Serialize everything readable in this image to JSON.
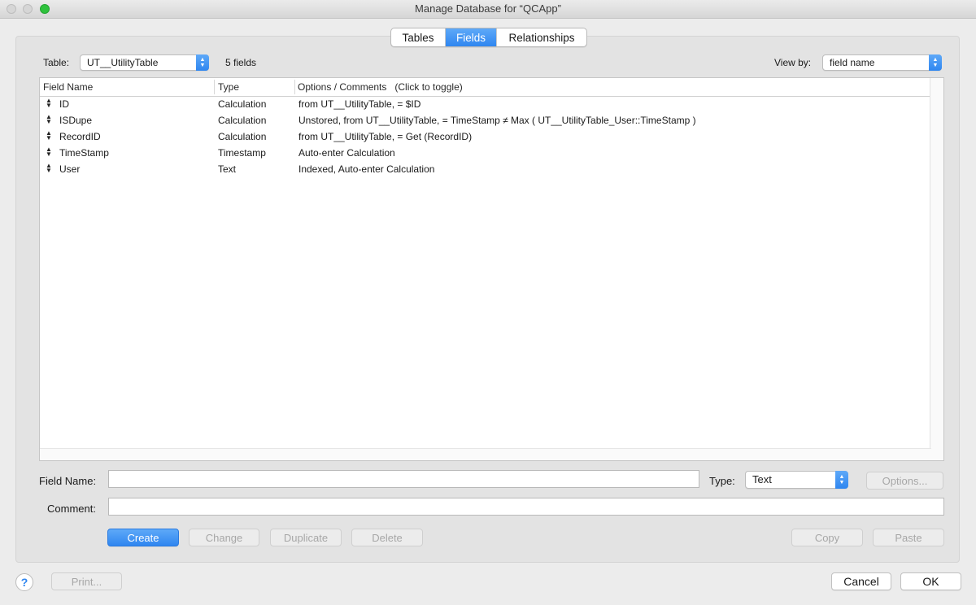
{
  "window": {
    "title": "Manage Database for “QCApp”"
  },
  "tabs": [
    {
      "label": "Tables",
      "active": false
    },
    {
      "label": "Fields",
      "active": true
    },
    {
      "label": "Relationships",
      "active": false
    }
  ],
  "table_selector": {
    "label": "Table:",
    "value": "UT__UtilityTable",
    "count_text": "5 fields"
  },
  "view_by": {
    "label": "View by:",
    "value": "field name"
  },
  "columns": [
    "Field Name",
    "Type",
    "Options / Comments   (Click to toggle)"
  ],
  "rows": [
    {
      "name": "ID",
      "type": "Calculation",
      "options": "from UT__UtilityTable, = $ID"
    },
    {
      "name": "ISDupe",
      "type": "Calculation",
      "options": "Unstored, from UT__UtilityTable, = TimeStamp ≠ Max ( UT__UtilityTable_User::TimeStamp )"
    },
    {
      "name": "RecordID",
      "type": "Calculation",
      "options": "from UT__UtilityTable, = Get (RecordID)"
    },
    {
      "name": "TimeStamp",
      "type": "Timestamp",
      "options": "Auto-enter Calculation"
    },
    {
      "name": "User",
      "type": "Text",
      "options": "Indexed, Auto-enter Calculation"
    }
  ],
  "form": {
    "field_name_label": "Field Name:",
    "field_name_value": "",
    "type_label": "Type:",
    "type_value": "Text",
    "options_label": "Options...",
    "comment_label": "Comment:",
    "comment_value": ""
  },
  "actions": {
    "create": "Create",
    "change": "Change",
    "duplicate": "Duplicate",
    "delete": "Delete",
    "copy": "Copy",
    "paste": "Paste"
  },
  "footer": {
    "help": "?",
    "print": "Print...",
    "cancel": "Cancel",
    "ok": "OK"
  },
  "icons": {
    "row_handle": "updown-arrow-icon",
    "stepper": "chevron-updown-icon"
  },
  "colors": {
    "accent": "#2f86f0",
    "zoom_button": "#2fc23d"
  }
}
